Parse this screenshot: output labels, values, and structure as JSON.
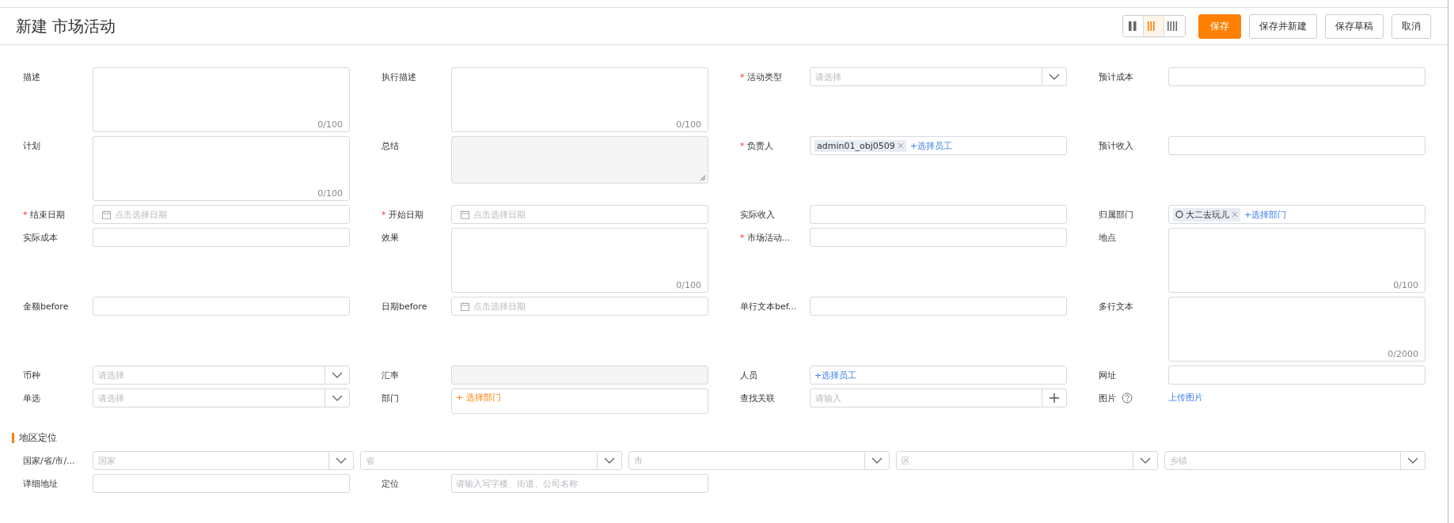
{
  "header": {
    "title": "新建 市场活动",
    "layouts": [
      {
        "selected": false
      },
      {
        "selected": true
      },
      {
        "selected": false
      }
    ],
    "buttons": [
      {
        "label": "保存",
        "kind": "primary"
      },
      {
        "label": "保存并新建",
        "kind": "default"
      },
      {
        "label": "保存草稿",
        "kind": "default"
      },
      {
        "label": "取消",
        "kind": "default"
      }
    ]
  },
  "fields": [
    {
      "label": "描述",
      "kind": "textarea",
      "counter": "0/100"
    },
    {
      "label": "执行描述",
      "kind": "textarea",
      "counter": "0/100"
    },
    {
      "asterisk": "*",
      "label": "活动类型",
      "kind": "select",
      "placeholder": "请选择"
    },
    {
      "label": "预计成本",
      "kind": "input"
    },
    {
      "label": "计划",
      "kind": "textarea",
      "counter": "0/100"
    },
    {
      "label": "总结",
      "kind": "readonly-textarea"
    },
    {
      "asterisk": "*",
      "label": "负责人",
      "kind": "members",
      "tags": [
        {
          "text": "admin01_obj0509",
          "kind": "user"
        }
      ],
      "link": "+选择员工"
    },
    {
      "label": "预计收入",
      "kind": "input"
    },
    {
      "asterisk": "*",
      "label": "结束日期",
      "kind": "date",
      "placeholder": "点击选择日期"
    },
    {
      "asterisk": "*",
      "label": "开始日期",
      "kind": "date",
      "placeholder": "点击选择日期"
    },
    {
      "label": "实际收入",
      "kind": "input"
    },
    {
      "label": "归属部门",
      "kind": "members",
      "tags": [
        {
          "text": "大二去玩儿",
          "kind": "department"
        }
      ],
      "link": "+选择部门"
    },
    {
      "label": "实际成本",
      "kind": "input"
    },
    {
      "label": "效果",
      "kind": "textarea",
      "counter": "0/100"
    },
    {
      "asterisk": "*",
      "label": "市场活动...",
      "kind": "input"
    },
    {
      "label": "地点",
      "kind": "textarea",
      "counter": "0/100"
    },
    {
      "label": "金额before",
      "kind": "input"
    },
    {
      "label": "日期before",
      "kind": "date",
      "placeholder": "点击选择日期"
    },
    {
      "label": "单行文本bef...",
      "kind": "input"
    },
    {
      "label": "多行文本",
      "kind": "textarea",
      "counter": "0/2000"
    },
    {
      "label": "币种",
      "kind": "select",
      "placeholder": "请选择"
    },
    {
      "label": "汇率",
      "kind": "readonly-input"
    },
    {
      "label": "人员",
      "kind": "members",
      "link": "+选择员工"
    },
    {
      "label": "网址",
      "kind": "input"
    },
    {
      "label": "单选",
      "kind": "select",
      "placeholder": "请选择"
    },
    {
      "label": "部门",
      "kind": "picker",
      "link": "+ 选择部门"
    },
    {
      "label": "查找关联",
      "kind": "lookup",
      "placeholder": "请输入"
    },
    {
      "label": "图片",
      "kind": "upload",
      "link": "上传图片"
    }
  ],
  "section": {
    "title": "地区定位",
    "region": {
      "label": "国家/省/市/...",
      "selects": [
        {
          "placeholder": "国家"
        },
        {
          "placeholder": "省"
        },
        {
          "placeholder": "市"
        },
        {
          "placeholder": "区"
        },
        {
          "placeholder": "乡镇"
        }
      ]
    },
    "fields": [
      {
        "label": "详细地址",
        "kind": "input"
      },
      {
        "label": "定位",
        "kind": "input",
        "placeholder": "请输入写字楼、街道、公司名称"
      }
    ]
  }
}
